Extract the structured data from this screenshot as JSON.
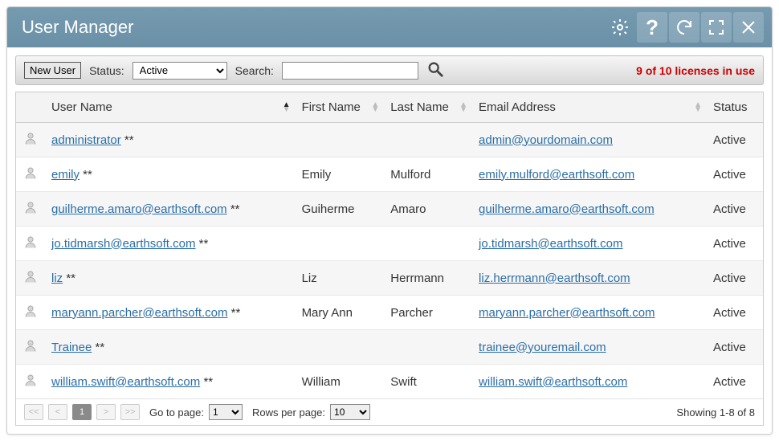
{
  "window": {
    "title": "User Manager"
  },
  "toolbar": {
    "new_user_label": "New User",
    "status_label": "Status:",
    "status_value": "Active",
    "search_label": "Search:",
    "search_value": "",
    "licenses_text": "9 of 10 licenses in use"
  },
  "columns": {
    "username": "User Name",
    "firstname": "First Name",
    "lastname": "Last Name",
    "email": "Email Address",
    "status": "Status"
  },
  "rows": [
    {
      "username": "administrator",
      "suffix": " **",
      "firstname": "",
      "lastname": "",
      "email": "admin@yourdomain.com",
      "status": "Active"
    },
    {
      "username": "emily",
      "suffix": " **",
      "firstname": "Emily",
      "lastname": "Mulford",
      "email": "emily.mulford@earthsoft.com",
      "status": "Active"
    },
    {
      "username": "guilherme.amaro@earthsoft.com",
      "suffix": " **",
      "firstname": "Guiherme",
      "lastname": "Amaro",
      "email": "guilherme.amaro@earthsoft.com",
      "status": "Active"
    },
    {
      "username": "jo.tidmarsh@earthsoft.com",
      "suffix": " **",
      "firstname": "",
      "lastname": "",
      "email": "jo.tidmarsh@earthsoft.com",
      "status": "Active"
    },
    {
      "username": "liz",
      "suffix": " **",
      "firstname": "Liz",
      "lastname": "Herrmann",
      "email": "liz.herrmann@earthsoft.com",
      "status": "Active"
    },
    {
      "username": "maryann.parcher@earthsoft.com",
      "suffix": " **",
      "firstname": "Mary Ann",
      "lastname": "Parcher",
      "email": "maryann.parcher@earthsoft.com",
      "status": "Active"
    },
    {
      "username": "Trainee",
      "suffix": " **",
      "firstname": "",
      "lastname": "",
      "email": "trainee@youremail.com",
      "status": "Active"
    },
    {
      "username": "william.swift@earthsoft.com",
      "suffix": " **",
      "firstname": "William",
      "lastname": "Swift",
      "email": "william.swift@earthsoft.com",
      "status": "Active"
    }
  ],
  "pager": {
    "first": "<<",
    "prev": "<",
    "current": "1",
    "next": ">",
    "last": ">>",
    "goto_label": "Go to page:",
    "goto_value": "1",
    "rows_label": "Rows per page:",
    "rows_value": "10",
    "showing": "Showing 1-8 of 8"
  }
}
